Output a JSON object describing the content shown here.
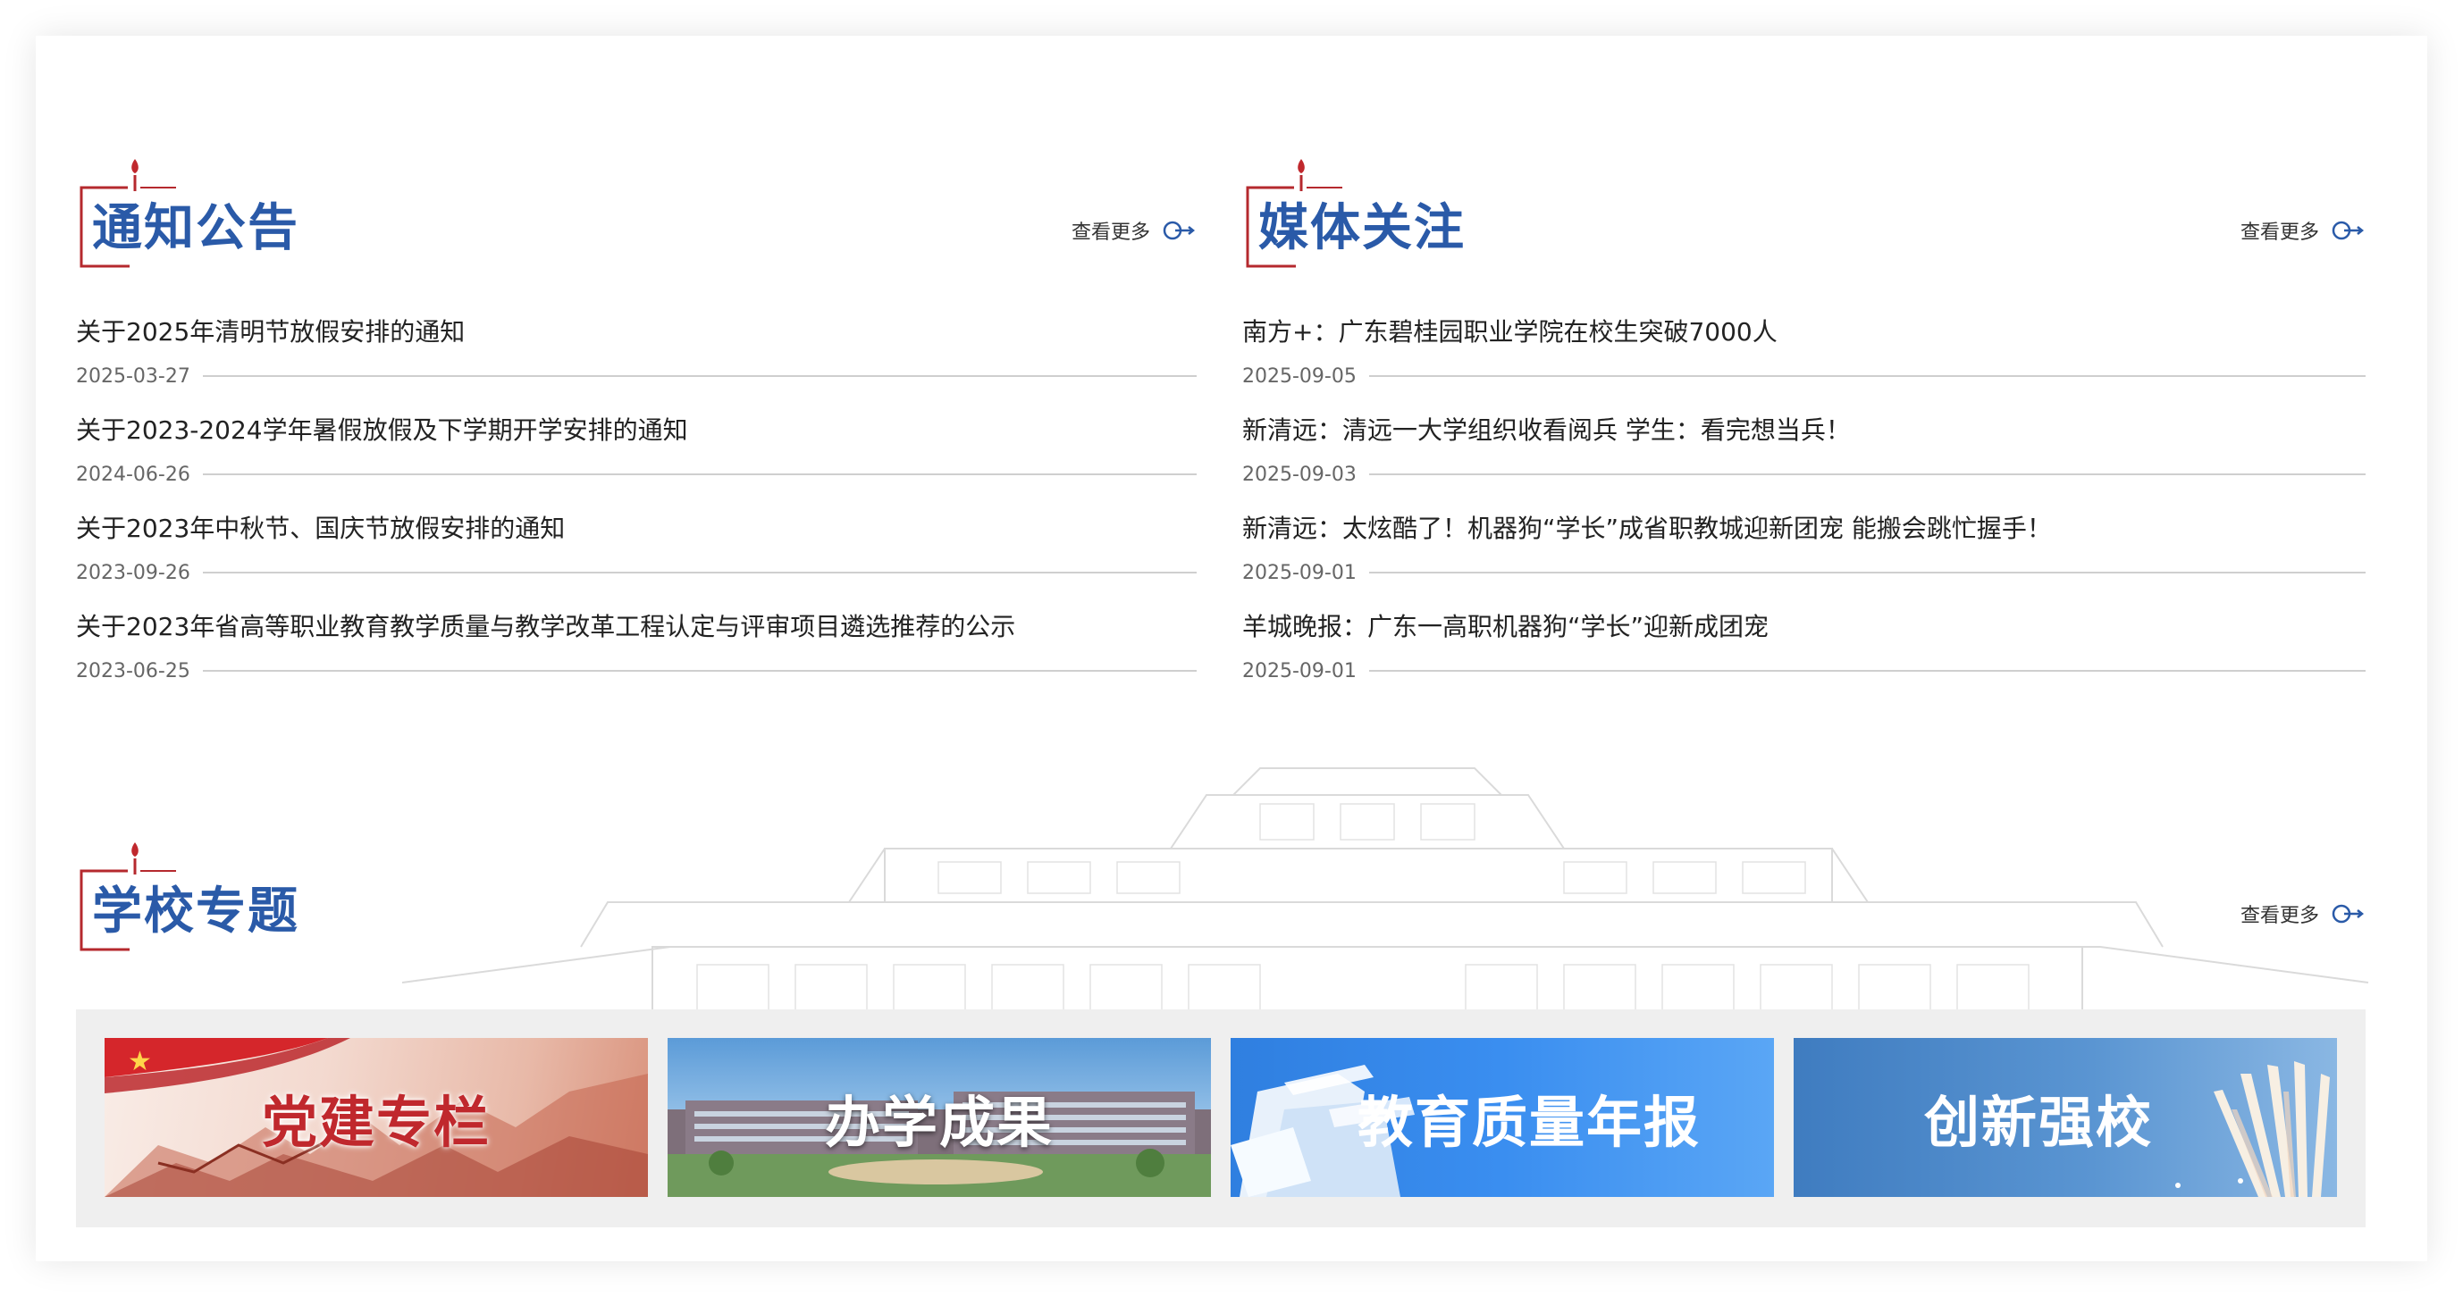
{
  "sections": {
    "notices": {
      "title": "通知公告",
      "more_label": "查看更多",
      "items": [
        {
          "title": "关于2025年清明节放假安排的通知",
          "date": "2025-03-27"
        },
        {
          "title": "关于2023-2024学年暑假放假及下学期开学安排的通知",
          "date": "2024-06-26"
        },
        {
          "title": "关于2023年中秋节、国庆节放假安排的通知",
          "date": "2023-09-26"
        },
        {
          "title": "关于2023年省高等职业教育教学质量与教学改革工程认定与评审项目遴选推荐的公示",
          "date": "2023-06-25"
        }
      ]
    },
    "media": {
      "title": "媒体关注",
      "more_label": "查看更多",
      "items": [
        {
          "title": "南方+：广东碧桂园职业学院在校生突破7000人",
          "date": "2025-09-05"
        },
        {
          "title": "新清远：清远一大学组织收看阅兵 学生：看完想当兵！",
          "date": "2025-09-03"
        },
        {
          "title": "新清远：太炫酷了！机器狗“学长”成省职教城迎新团宠 能搬会跳忙握手！",
          "date": "2025-09-01"
        },
        {
          "title": "羊城晚报：广东一高职机器狗“学长”迎新成团宠",
          "date": "2025-09-01"
        }
      ]
    },
    "topics": {
      "title": "学校专题",
      "more_label": "查看更多",
      "tiles": [
        {
          "label": "党建专栏",
          "icon": "party-flag-great-wall"
        },
        {
          "label": "办学成果",
          "icon": "campus-building"
        },
        {
          "label": "教育质量年报",
          "icon": "documents"
        },
        {
          "label": "创新强校",
          "icon": "open-book"
        }
      ]
    }
  },
  "colors": {
    "heading_blue": "#2a5aa8",
    "emblem_red": "#b5292e",
    "tile_party_red": "#c0282d"
  }
}
